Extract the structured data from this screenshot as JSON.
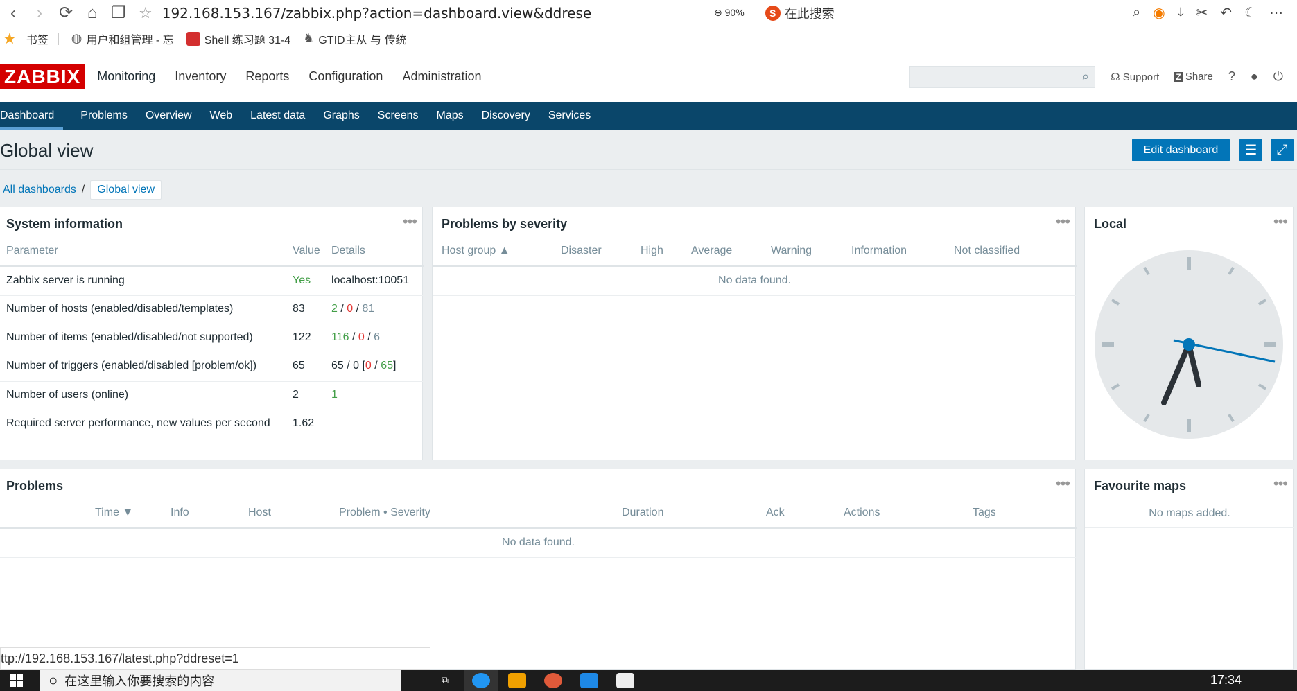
{
  "browser": {
    "url": "192.168.153.167/zabbix.php?action=dashboard.view&ddrese",
    "zoom": "90%",
    "search_label": "在此搜索"
  },
  "bookmarks": {
    "label": "书签",
    "items": [
      "用户和组管理 - 忘",
      "Shell 练习题 31-4",
      "GTID主从 与 传统"
    ]
  },
  "header": {
    "logo": "ZABBIX",
    "menu": [
      "Monitoring",
      "Inventory",
      "Reports",
      "Configuration",
      "Administration"
    ],
    "support": "Support",
    "share": "Share",
    "help": "?"
  },
  "submenu": [
    "Dashboard",
    "Problems",
    "Overview",
    "Web",
    "Latest data",
    "Graphs",
    "Screens",
    "Maps",
    "Discovery",
    "Services"
  ],
  "page": {
    "title": "Global view",
    "edit_button": "Edit dashboard",
    "breadcrumb_root": "All dashboards",
    "breadcrumb_sep": "/",
    "breadcrumb_current": "Global view"
  },
  "sysinfo": {
    "title": "System information",
    "cols": [
      "Parameter",
      "Value",
      "Details"
    ],
    "rows": [
      {
        "param": "Zabbix server is running",
        "value": "Yes",
        "details": "localhost:10051"
      },
      {
        "param": "Number of hosts (enabled/disabled/templates)",
        "value": "83",
        "d1": "2",
        "d2": "0",
        "d3": "81"
      },
      {
        "param": "Number of items (enabled/disabled/not supported)",
        "value": "122",
        "d1": "116",
        "d2": "0",
        "d3": "6"
      },
      {
        "param": "Number of triggers (enabled/disabled [problem/ok])",
        "value": "65",
        "dprefix": "65 / 0 [",
        "d2": "0",
        "d3": "65",
        "dsuffix": "]"
      },
      {
        "param": "Number of users (online)",
        "value": "2",
        "d1": "1"
      },
      {
        "param": "Required server performance, new values per second",
        "value": "1.62"
      }
    ],
    "slash": "/"
  },
  "severity": {
    "title": "Problems by severity",
    "cols": [
      "Host group ▲",
      "Disaster",
      "High",
      "Average",
      "Warning",
      "Information",
      "Not classified"
    ],
    "empty": "No data found."
  },
  "clock": {
    "title": "Local"
  },
  "problems": {
    "title": "Problems",
    "cols": [
      "Time ▼",
      "Info",
      "Host",
      "Problem • Severity",
      "Duration",
      "Ack",
      "Actions",
      "Tags"
    ],
    "empty": "No data found."
  },
  "favmaps": {
    "title": "Favourite maps",
    "empty": "No maps added."
  },
  "statusbar": "ttp://192.168.153.167/latest.php?ddreset=1",
  "taskbar": {
    "search": "在这里输入你要搜索的内容",
    "time": "17:34"
  },
  "menu_dots": "•••"
}
